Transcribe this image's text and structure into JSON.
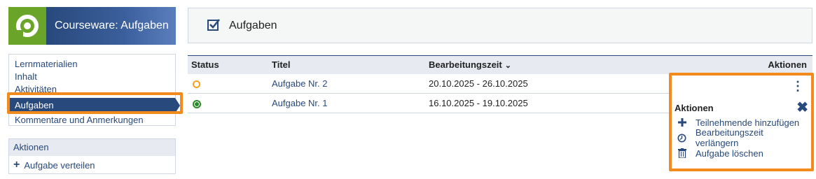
{
  "app": {
    "title": "Courseware: Aufgaben"
  },
  "sidebar": {
    "items": [
      {
        "label": "Lernmaterialien"
      },
      {
        "label": "Inhalt"
      },
      {
        "label": "Aktivitäten"
      },
      {
        "label": "Aufgaben",
        "active": true
      },
      {
        "label": "Kommentare und Anmerkungen"
      }
    ],
    "actions_title": "Aktionen",
    "actions": [
      {
        "label": "Aufgabe verteilen",
        "icon": "plus-icon"
      }
    ]
  },
  "content": {
    "title": "Aufgaben",
    "icon": "task-checkbox-icon"
  },
  "table": {
    "headers": {
      "status": "Status",
      "title": "Titel",
      "time": "Bearbeitungszeit",
      "actions": "Aktionen"
    },
    "rows": [
      {
        "status": "open",
        "title": "Aufgabe Nr. 2",
        "time": "20.10.2025 - 26.10.2025"
      },
      {
        "status": "done",
        "title": "Aufgabe Nr. 1",
        "time": "16.10.2025 - 19.10.2025"
      }
    ]
  },
  "menu": {
    "title": "Aktionen",
    "items": [
      {
        "label": "Teilnehmende hinzufügen",
        "icon": "plus-icon"
      },
      {
        "label": "Bearbeitungszeit verlängern",
        "icon": "clock-icon"
      },
      {
        "label": "Aufgabe löschen",
        "icon": "trash-icon"
      }
    ]
  },
  "colors": {
    "primary": "#28497c",
    "accent": "#f28a1c",
    "logo": "#6aa52a",
    "status_open": "#f7a21c",
    "status_done": "#2b8a28"
  }
}
